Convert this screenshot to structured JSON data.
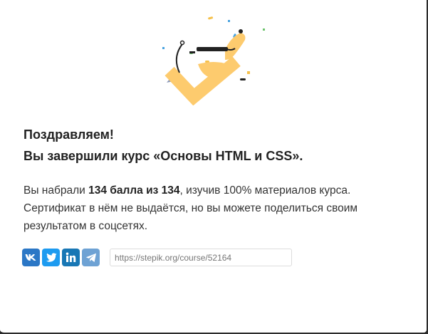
{
  "heading": {
    "line1": "Поздравляем!",
    "line2": "Вы завершили курс «Основы HTML и CSS»."
  },
  "message": {
    "pre_score": "Вы набрали ",
    "score": "134 балла из 134",
    "post_score": ", изучив 100% материалов курса.",
    "line2": "Сертификат в нём не выдаётся, но вы можете поделиться своим",
    "line3": "результатом в соцсетях."
  },
  "share": {
    "buttons": [
      {
        "icon": "vk-icon",
        "color": "#2b77c6"
      },
      {
        "icon": "twitter-icon",
        "color": "#1d9bf0"
      },
      {
        "icon": "linkedin-icon",
        "color": "#1877b5"
      },
      {
        "icon": "telegram-icon",
        "color": "#6ea2d4"
      }
    ],
    "url_value": "https://stepik.org/course/52164"
  },
  "illustration": {
    "icon": "success-checkmark-dog-illustration",
    "accent": "#fdcb6e"
  }
}
